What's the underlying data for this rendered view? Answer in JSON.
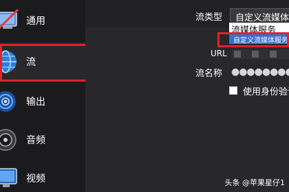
{
  "sidebar": {
    "items": [
      {
        "label": "通用",
        "icon": "general-settings-icon"
      },
      {
        "label": "流",
        "icon": "stream-globe-icon"
      },
      {
        "label": "输出",
        "icon": "output-broadcast-icon"
      },
      {
        "label": "音频",
        "icon": "audio-speaker-icon"
      },
      {
        "label": "视频",
        "icon": "video-monitor-icon"
      }
    ],
    "active_item": "流"
  },
  "stream_settings": {
    "type_label": "流类型",
    "type_value": "自定义流媒体",
    "dropdown_options": [
      "流媒体服务",
      "自定义流媒体服务器"
    ],
    "url_label": "URL",
    "key_label": "流名称",
    "key_value": "●●●●●●●●●",
    "auth_label": "使用身份验证",
    "auth_checked": false
  },
  "watermark": "头条 @苹果星仔1",
  "colors": {
    "highlight": "#e3212a",
    "selected_option": "#3a6ed1"
  }
}
